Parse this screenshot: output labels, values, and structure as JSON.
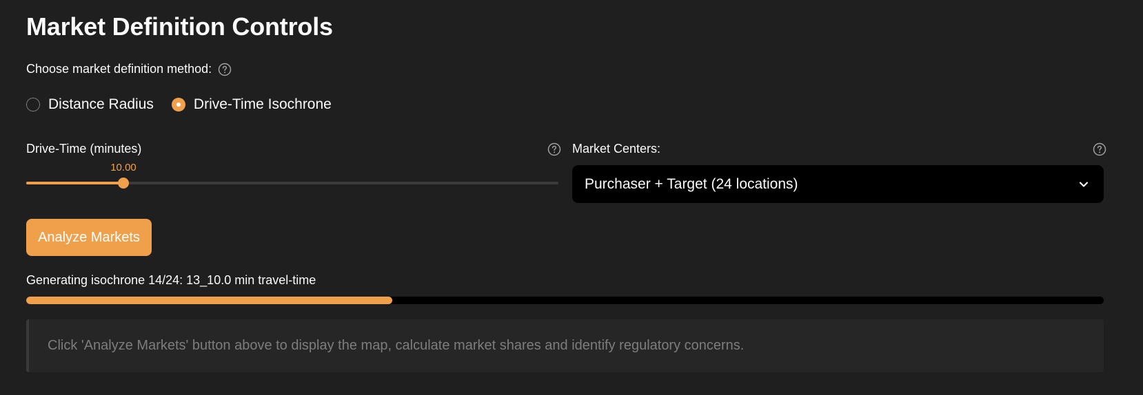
{
  "header": {
    "title": "Market Definition Controls"
  },
  "method": {
    "label": "Choose market definition method:",
    "help_icon": "question-circle-icon",
    "options": [
      {
        "label": "Distance Radius",
        "selected": false
      },
      {
        "label": "Drive-Time Isochrone",
        "selected": true
      }
    ]
  },
  "drive_time": {
    "label": "Drive-Time (minutes)",
    "value_text": "10.00",
    "value": 10.0,
    "fill_fraction": 0.183,
    "help_icon": "question-circle-icon"
  },
  "market_centers": {
    "label": "Market Centers:",
    "selected": "Purchaser + Target (24 locations)",
    "help_icon": "question-circle-icon",
    "dropdown_icon": "chevron-down-icon"
  },
  "actions": {
    "analyze_label": "Analyze Markets"
  },
  "progress": {
    "text": "Generating isochrone 14/24: 13_10.0 min travel-time",
    "fraction": 0.3396
  },
  "info": {
    "text": "Click 'Analyze Markets' button above to display the map, calculate market shares and identify regulatory concerns."
  },
  "colors": {
    "accent": "#f0a04b",
    "background": "#1f1f1f",
    "select_background": "#000000",
    "info_background": "#262626",
    "muted_text": "#7d7d7d"
  }
}
